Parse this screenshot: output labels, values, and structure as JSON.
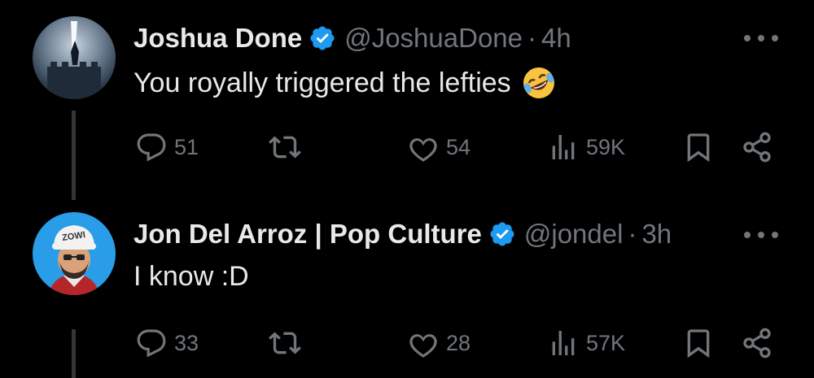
{
  "tweets": [
    {
      "name": "Joshua Done",
      "handle": "@JoshuaDone",
      "dot": "·",
      "time": "4h",
      "text": "You royally triggered the lefties",
      "emoji": "rolling-on-floor-laughing",
      "replies": "51",
      "likes": "54",
      "views": "59K"
    },
    {
      "name": "Jon Del Arroz | Pop Culture",
      "handle": "@jondel",
      "dot": "·",
      "time": "3h",
      "text": "I know :D",
      "replies": "33",
      "likes": "28",
      "views": "57K"
    }
  ],
  "icons": {
    "reply": "reply-icon",
    "retweet": "retweet-icon",
    "like": "heart-icon",
    "views": "views-icon",
    "bookmark": "bookmark-icon",
    "share": "share-icon",
    "more": "more-icon",
    "verified": "verified-badge-icon"
  },
  "colors": {
    "background": "#000000",
    "text": "#e7e9ea",
    "muted": "#71767b",
    "verified": "#1d9bf0"
  }
}
